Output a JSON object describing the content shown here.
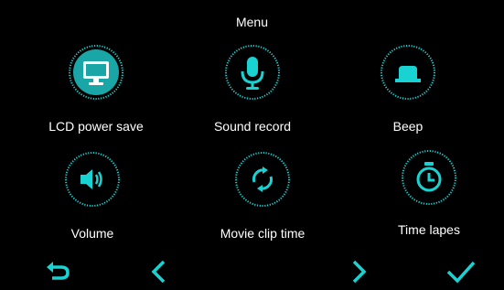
{
  "menu": {
    "title": "Menu",
    "items": [
      {
        "label": "LCD power save",
        "icon": "monitor-icon",
        "selected": true
      },
      {
        "label": "Sound record",
        "icon": "microphone-icon",
        "selected": false
      },
      {
        "label": "Beep",
        "icon": "beep-icon",
        "selected": false
      },
      {
        "label": "Volume",
        "icon": "speaker-icon",
        "selected": false
      },
      {
        "label": "Movie clip time",
        "icon": "loop-arrows-icon",
        "selected": false
      },
      {
        "label": "Time lapes",
        "icon": "stopwatch-icon",
        "selected": false
      }
    ]
  },
  "nav": {
    "buttons": [
      "back-icon",
      "prev-icon",
      "next-icon",
      "confirm-icon"
    ]
  },
  "colors": {
    "accent": "#19d3d3",
    "selected_fill": "#1aa6a6",
    "background": "#000000",
    "text": "#ffffff"
  }
}
